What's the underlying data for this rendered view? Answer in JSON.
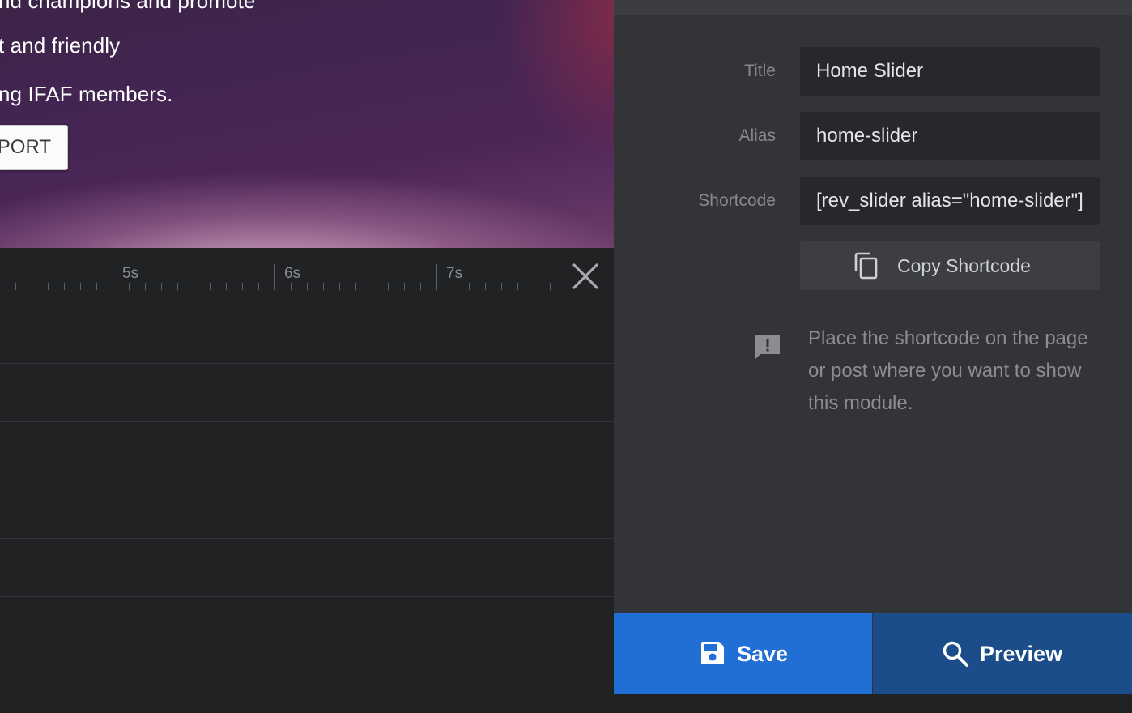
{
  "slide": {
    "lines": [
      "nd champions and promote",
      "t and friendly",
      "ng IFAF members."
    ],
    "button_label": "PORT"
  },
  "timeline": {
    "ticks": [
      "5s",
      "6s",
      "7s"
    ],
    "close_icon": "close-icon"
  },
  "settings": {
    "title_label": "Title",
    "title_value": "Home Slider",
    "alias_label": "Alias",
    "alias_value": "home-slider",
    "shortcode_label": "Shortcode",
    "shortcode_value": "[rev_slider alias=\"home-slider\"][/rev_slider]",
    "copy_button_label": "Copy Shortcode",
    "info_text": "Place the shortcode on the page or post where you want to show this module."
  },
  "actions": {
    "save_label": "Save",
    "preview_label": "Preview"
  },
  "colors": {
    "save": "#216ed4",
    "preview": "#1b4d8a",
    "panel": "#333438",
    "timeline": "#212224"
  }
}
